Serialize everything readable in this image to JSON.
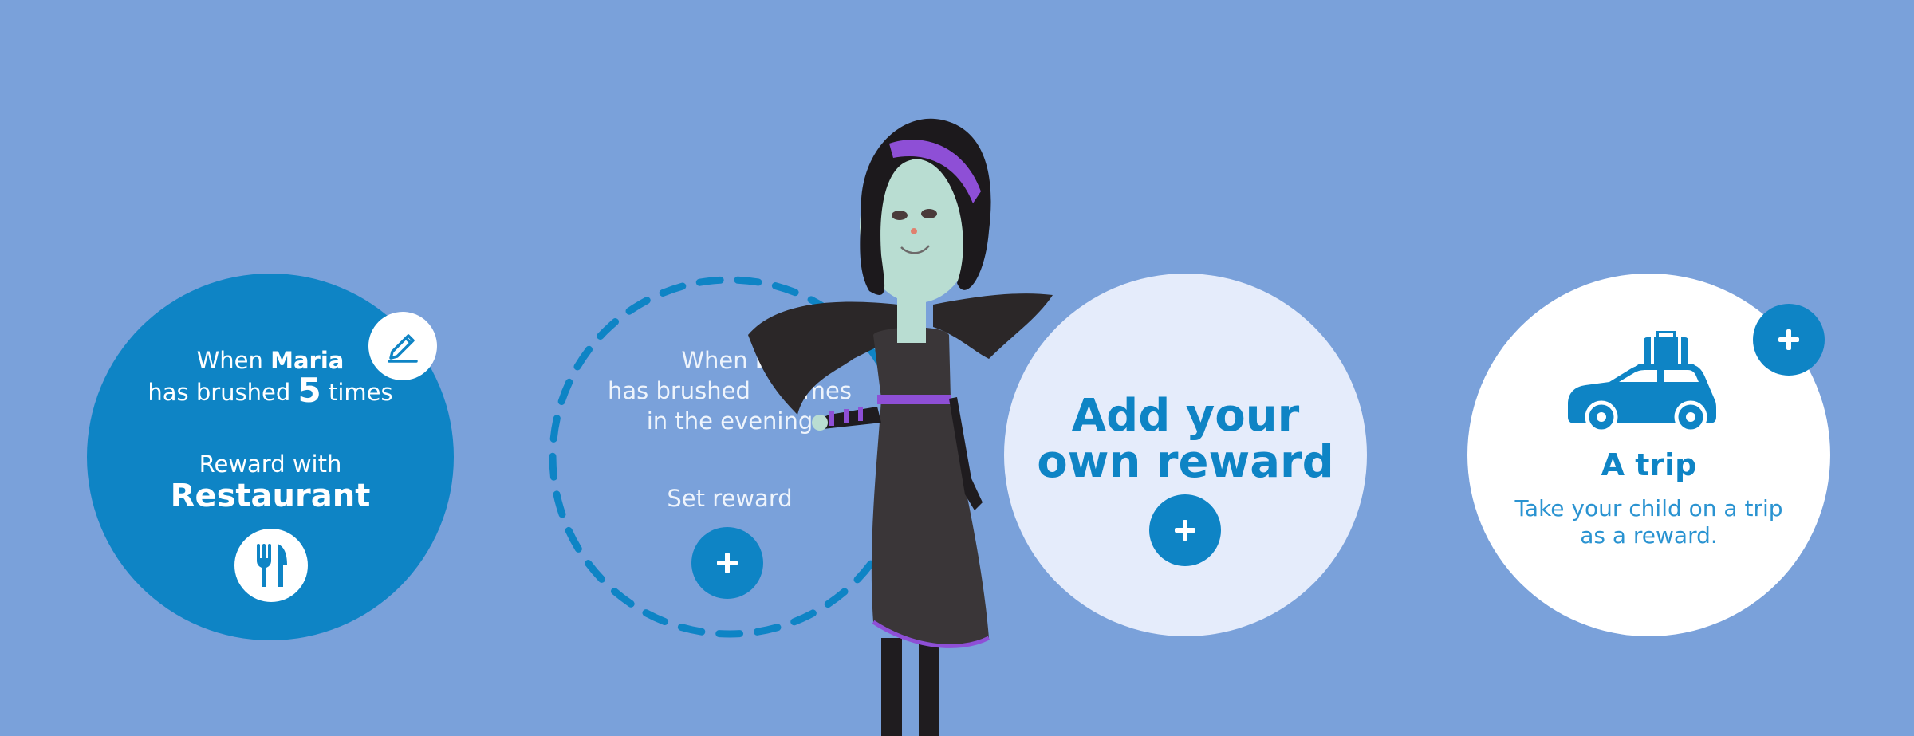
{
  "reward_card_active": {
    "condition_prefix": "When",
    "child_name": "Maria",
    "condition_middle": "has brushed",
    "count": "5",
    "condition_suffix": "times",
    "reward_prefix": "Reward with",
    "reward_name": "Restaurant",
    "edit_icon": "pencil-icon",
    "reward_icon": "fork-knife-icon"
  },
  "reward_card_empty": {
    "line1_prefix": "When",
    "line1_name": "M",
    "line2_left": "has brushed",
    "line2_right": "times",
    "line3": "in the evening",
    "set_reward_label": "Set reward",
    "add_icon": "plus-icon"
  },
  "reward_card_custom": {
    "title_line1": "Add your",
    "title_line2": "own reward",
    "add_icon": "plus-icon"
  },
  "reward_card_trip": {
    "title": "A trip",
    "description_line1": "Take your child on a trip",
    "description_line2": "as a reward.",
    "icon": "car-with-luggage-icon",
    "add_icon": "plus-icon"
  },
  "colors": {
    "background": "#7aa1da",
    "brand_blue": "#0e84c5",
    "custom_card_bg": "#e5ecfb",
    "white": "#ffffff"
  }
}
